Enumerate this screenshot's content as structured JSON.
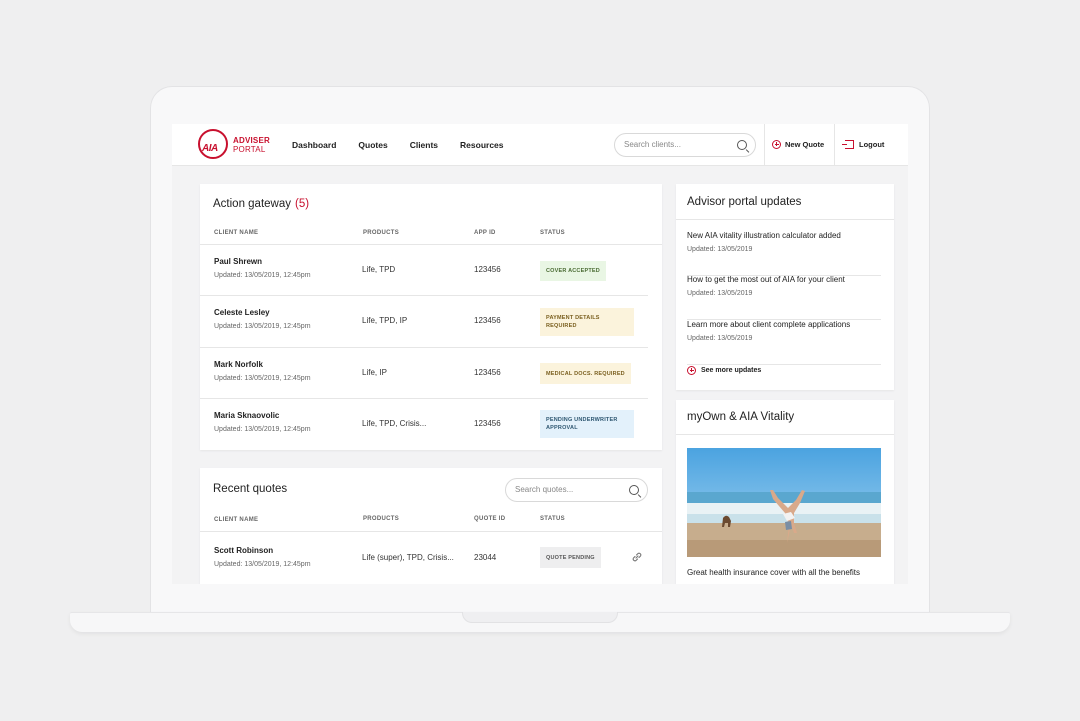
{
  "header": {
    "logo_mark": "AIA",
    "logo_line1": "ADVISER",
    "logo_line2": "PORTAL",
    "nav": [
      "Dashboard",
      "Quotes",
      "Clients",
      "Resources"
    ],
    "search_placeholder": "Search clients...",
    "new_quote_label": "New Quote",
    "logout_label": "Logout"
  },
  "action_gateway": {
    "title": "Action gateway",
    "count": "(5)",
    "columns": [
      "CLIENT NAME",
      "PRODUCTS",
      "APP ID",
      "STATUS"
    ],
    "rows": [
      {
        "name": "Paul Shrewn",
        "updated": "Updated: 13/05/2019, 12:45pm",
        "products": "Life, TPD",
        "app_id": "123456",
        "status": "COVER ACCEPTED",
        "status_bg": "#e9f6e4"
      },
      {
        "name": "Celeste Lesley",
        "updated": "Updated: 13/05/2019, 12:45pm",
        "products": "Life, TPD, IP",
        "app_id": "123456",
        "status": "PAYMENT DETAILS REQUIRED",
        "status_bg": "#fbf3dc"
      },
      {
        "name": "Mark Norfolk",
        "updated": "Updated: 13/05/2019, 12:45pm",
        "products": "Life, IP",
        "app_id": "123456",
        "status": "MEDICAL DOCS. REQUIRED",
        "status_bg": "#fbf3dc"
      },
      {
        "name": "Maria Sknaovolic",
        "updated": "Updated: 13/05/2019, 12:45pm",
        "products": "Life, TPD, Crisis...",
        "app_id": "123456",
        "status": "PENDING UNDERWRITER APPROVAL",
        "status_bg": "#e3f1fb"
      }
    ]
  },
  "recent_quotes": {
    "title": "Recent quotes",
    "search_placeholder": "Search quotes...",
    "columns": [
      "CLIENT NAME",
      "PRODUCTS",
      "QUOTE ID",
      "STATUS"
    ],
    "rows": [
      {
        "name": "Scott Robinson",
        "updated": "Updated: 13/05/2019, 12:45pm",
        "products": "Life (super), TPD, Crisis...",
        "quote_id": "23044",
        "status": "QUOTE PENDING",
        "status_bg": "#eeeeef"
      }
    ]
  },
  "updates": {
    "title": "Advisor portal updates",
    "items": [
      {
        "title": "New AIA vitality illustration calculator added",
        "date": "Updated: 13/05/2019"
      },
      {
        "title": "How to get the most out of AIA for your client",
        "date": "Updated: 13/05/2019"
      },
      {
        "title": "Learn more about client complete applications",
        "date": "Updated: 13/05/2019"
      }
    ],
    "see_more": "See more updates"
  },
  "vitality": {
    "title": "myOwn & AIA Vitality",
    "caption": "Great health insurance cover with all the benefits"
  },
  "colors": {
    "brand": "#c8102e"
  }
}
